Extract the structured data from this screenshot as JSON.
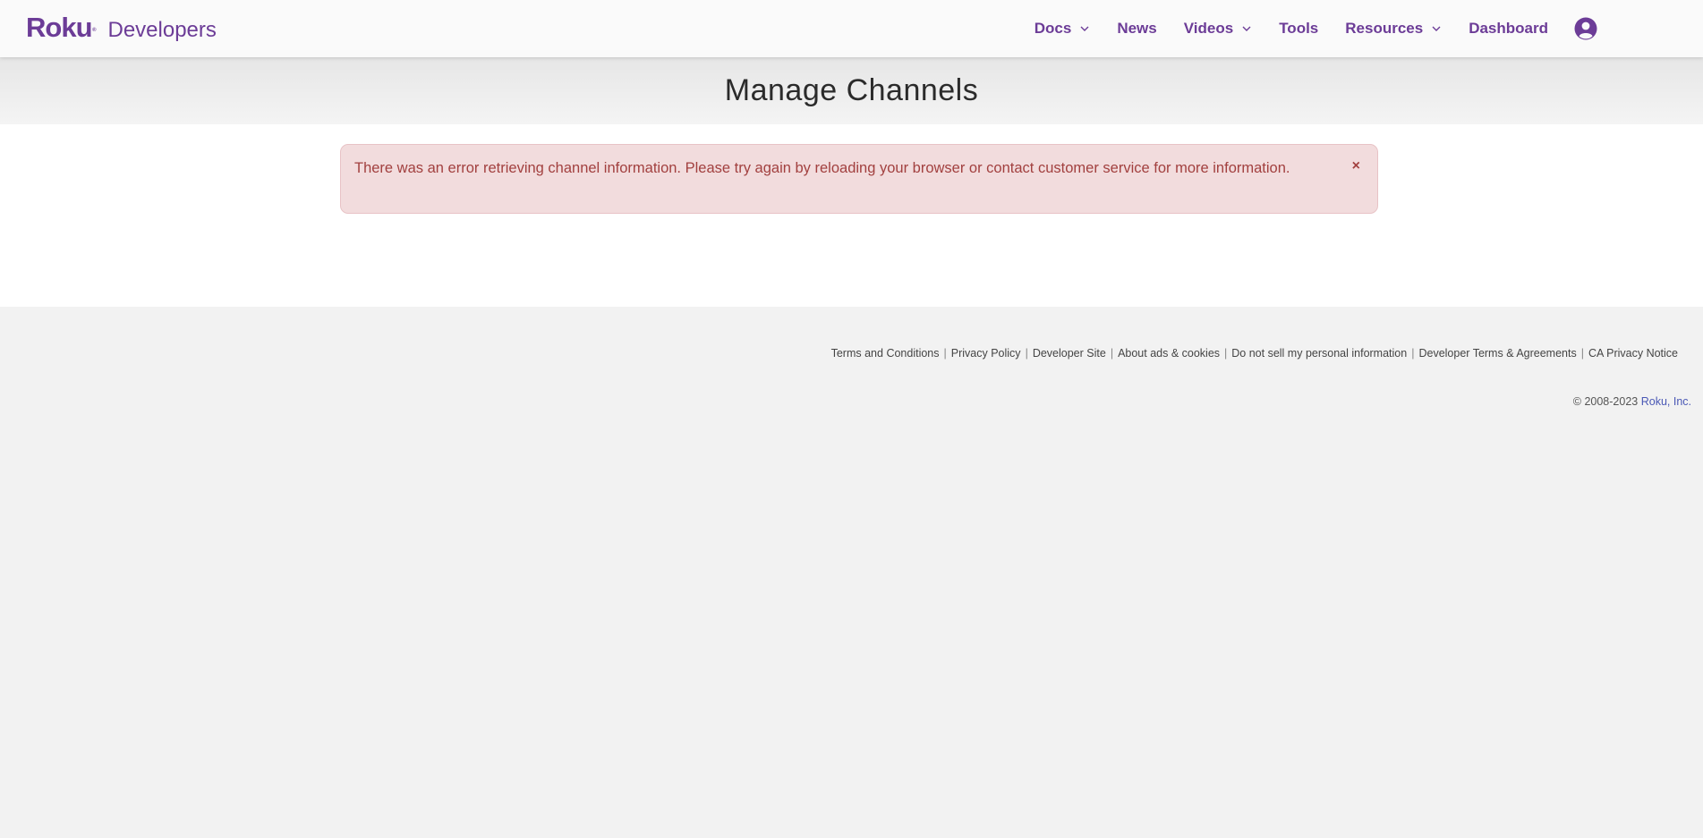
{
  "header": {
    "logo_text": "Roku",
    "logo_tm": "®",
    "brand_sub": "Developers",
    "nav": [
      {
        "label": "Docs",
        "has_dropdown": true
      },
      {
        "label": "News",
        "has_dropdown": false
      },
      {
        "label": "Videos",
        "has_dropdown": true
      },
      {
        "label": "Tools",
        "has_dropdown": false
      },
      {
        "label": "Resources",
        "has_dropdown": true
      },
      {
        "label": "Dashboard",
        "has_dropdown": false
      }
    ],
    "user_icon": "user-circle-icon"
  },
  "page": {
    "title": "Manage Channels"
  },
  "alert": {
    "message": "There was an error retrieving channel information. Please try again by reloading your browser or contact customer service for more information.",
    "close_label": "×"
  },
  "footer": {
    "links": [
      "Terms and Conditions",
      "Privacy Policy",
      "Developer Site",
      "About ads & cookies",
      "Do not sell my personal information",
      "Developer Terms & Agreements",
      "CA Privacy Notice"
    ],
    "separator": "|",
    "copyright_prefix": "© 2008-2023",
    "copyright_company": "Roku, Inc."
  },
  "colors": {
    "brand_purple": "#6c3c97",
    "alert_bg": "#f2dcdd",
    "alert_text": "#a2403f",
    "footer_bg": "#f2f2f2",
    "link_blue": "#4a58b5"
  }
}
